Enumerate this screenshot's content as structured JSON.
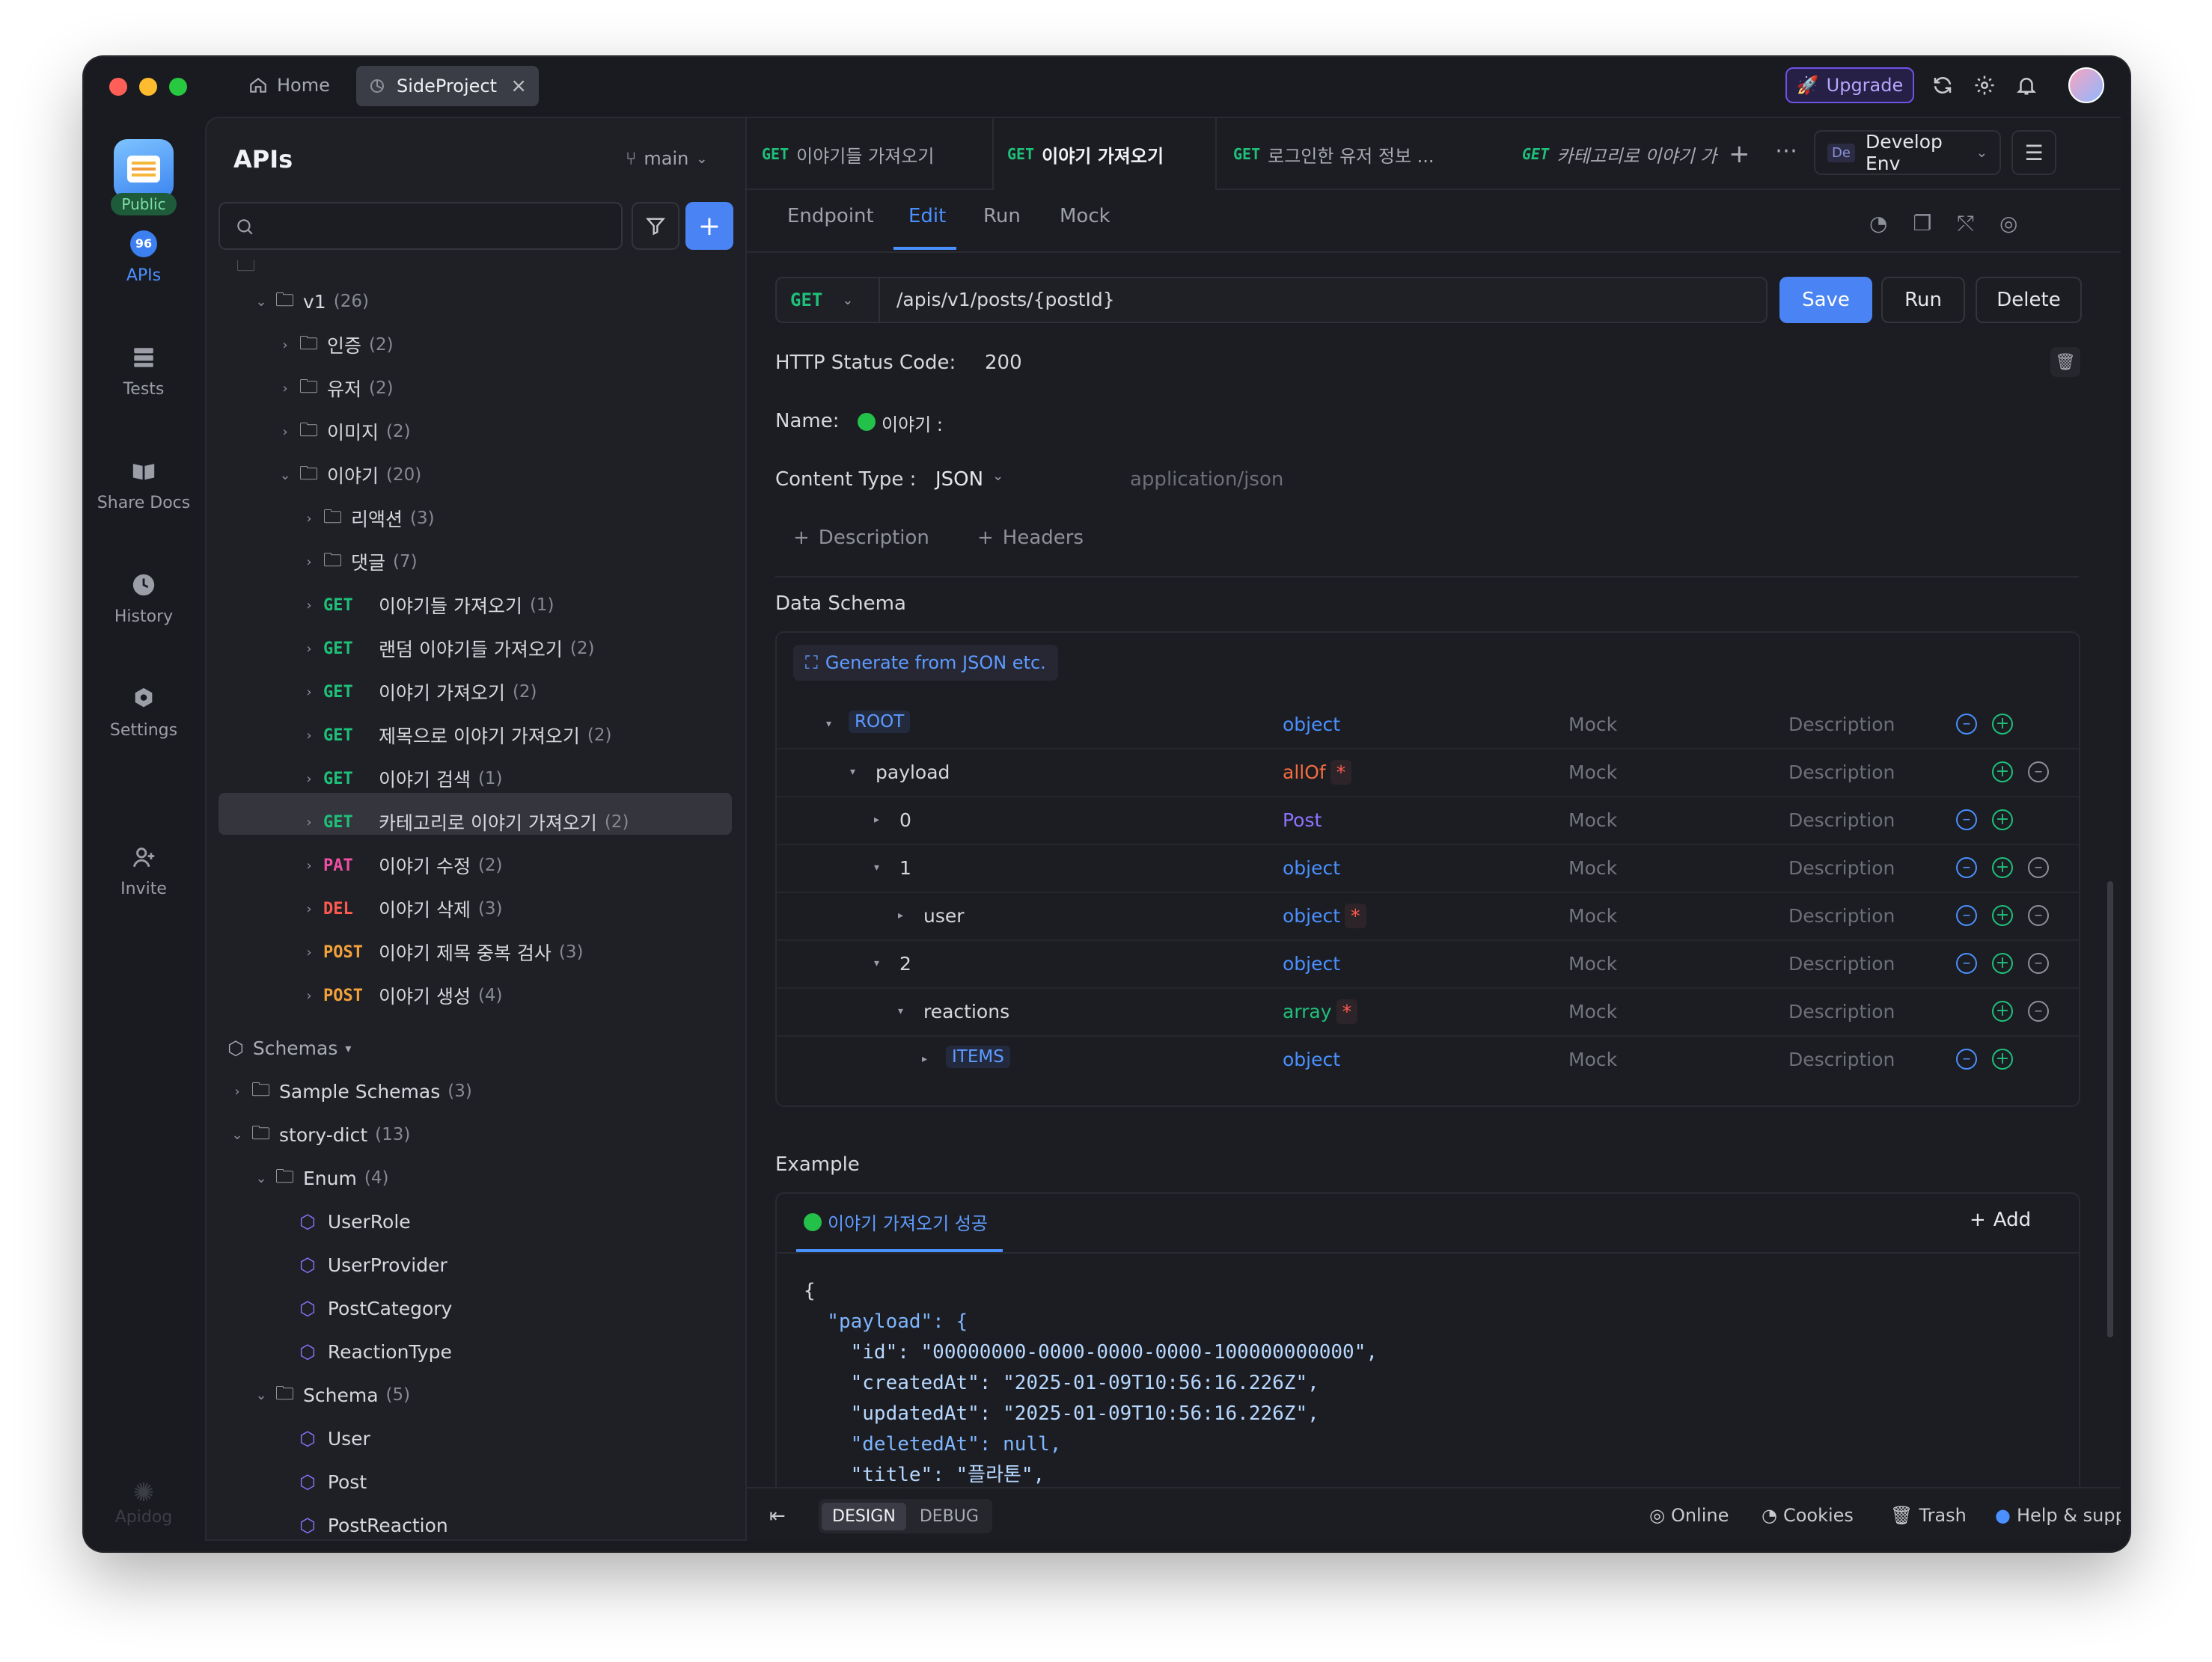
{
  "titlebar": {
    "home_tab": "Home",
    "active_tab": "SideProject",
    "upgrade_label": "Upgrade"
  },
  "rail": {
    "public_badge": "Public",
    "items": [
      {
        "label": "APIs",
        "icon": "api-icon"
      },
      {
        "label": "Tests",
        "icon": "tests-icon"
      },
      {
        "label": "Share Docs",
        "icon": "book-icon"
      },
      {
        "label": "History",
        "icon": "clock-icon"
      },
      {
        "label": "Settings",
        "icon": "gear-icon"
      },
      {
        "label": "Invite",
        "icon": "user-plus-icon"
      }
    ],
    "brand": "Apidog"
  },
  "sidebar": {
    "title": "APIs",
    "branch": "main",
    "search_placeholder": "",
    "tree": [
      {
        "label": "v1",
        "count": "(26)"
      },
      {
        "label": "인증",
        "count": "(2)"
      },
      {
        "label": "유저",
        "count": "(2)"
      },
      {
        "label": "이미지",
        "count": "(2)"
      },
      {
        "label": "이야기",
        "count": "(20)"
      },
      {
        "label": "리액션",
        "count": "(3)"
      },
      {
        "label": "댓글",
        "count": "(7)"
      }
    ],
    "endpoints": [
      {
        "method": "GET",
        "label": "이야기들 가져오기",
        "count": "(1)"
      },
      {
        "method": "GET",
        "label": "랜덤 이야기들 가져오기",
        "count": "(2)"
      },
      {
        "method": "GET",
        "label": "이야기 가져오기",
        "count": "(2)"
      },
      {
        "method": "GET",
        "label": "제목으로 이야기 가져오기",
        "count": "(2)"
      },
      {
        "method": "GET",
        "label": "이야기 검색",
        "count": "(1)"
      },
      {
        "method": "GET",
        "label": "카테고리로 이야기 가져오기",
        "count": "(2)"
      },
      {
        "method": "PAT",
        "label": "이야기 수정",
        "count": "(2)"
      },
      {
        "method": "DEL",
        "label": "이야기 삭제",
        "count": "(3)"
      },
      {
        "method": "POST",
        "label": "이야기 제목 중복 검사",
        "count": "(3)"
      },
      {
        "method": "POST",
        "label": "이야기 생성",
        "count": "(4)"
      }
    ],
    "schemas_title": "Schemas",
    "schema_tree": [
      {
        "label": "Sample Schemas",
        "count": "(3)"
      },
      {
        "label": "story-dict",
        "count": "(13)"
      },
      {
        "label": "Enum",
        "count": "(4)"
      },
      {
        "label": "UserRole"
      },
      {
        "label": "UserProvider"
      },
      {
        "label": "PostCategory"
      },
      {
        "label": "ReactionType"
      },
      {
        "label": "Schema",
        "count": "(5)"
      },
      {
        "label": "User"
      },
      {
        "label": "Post"
      },
      {
        "label": "PostReaction"
      }
    ]
  },
  "main": {
    "tabs": [
      {
        "method": "GET",
        "label": "이야기들 가져오기"
      },
      {
        "method": "GET",
        "label": "이야기 가져오기"
      },
      {
        "method": "GET",
        "label": "로그인한 유저 정보 ..."
      },
      {
        "method": "GET",
        "label": "카테고리로 이야기 가"
      }
    ],
    "env_badge": "De",
    "env_label": "Develop Env",
    "sub_tabs": [
      "Endpoint",
      "Edit",
      "Run",
      "Mock"
    ],
    "method": "GET",
    "url": "/apis/v1/posts/{postId}",
    "save_label": "Save",
    "run_label": "Run",
    "delete_label": "Delete",
    "status_label": "HTTP Status Code:",
    "status_value": "200",
    "name_label": "Name:",
    "name_value": "이야기 :",
    "content_type_label": "Content Type :",
    "content_type_value": "JSON",
    "content_type_mime": "application/json",
    "description_link": "Description",
    "headers_link": "Headers",
    "data_schema_title": "Data Schema",
    "generate_label": "Generate from JSON etc.",
    "schema_rows": [
      {
        "name": "ROOT",
        "type": "object",
        "mock": "Mock",
        "desc": "Description"
      },
      {
        "name": "payload",
        "type": "allOf",
        "mock": "Mock",
        "desc": "Description"
      },
      {
        "name": "0",
        "type": "Post",
        "mock": "Mock",
        "desc": "Description"
      },
      {
        "name": "1",
        "type": "object",
        "mock": "Mock",
        "desc": "Description"
      },
      {
        "name": "user",
        "type": "object",
        "mock": "Mock",
        "desc": "Description"
      },
      {
        "name": "2",
        "type": "object",
        "mock": "Mock",
        "desc": "Description"
      },
      {
        "name": "reactions",
        "type": "array",
        "mock": "Mock",
        "desc": "Description"
      },
      {
        "name": "ITEMS",
        "type": "object",
        "mock": "Mock",
        "desc": "Description"
      }
    ],
    "example_title": "Example",
    "example_tab": "이야기 가져오기 성공",
    "add_label": "Add",
    "code_lines": [
      "{",
      "  \"payload\": {",
      "    \"id\": \"00000000-0000-0000-0000-100000000000\",",
      "    \"createdAt\": \"2025-01-09T10:56:16.226Z\",",
      "    \"updatedAt\": \"2025-01-09T10:56:16.226Z\",",
      "    \"deletedAt\": null,",
      "    \"title\": \"플라톤\","
    ]
  },
  "bottom": {
    "design": "DESIGN",
    "debug": "DEBUG",
    "online": "Online",
    "cookies": "Cookies",
    "trash": "Trash",
    "help": "Help & support"
  },
  "colors": {
    "accent": "#4a90ff",
    "get": "#1fc07a",
    "patch": "#ee4fa2",
    "delete": "#ff5a4f",
    "post": "#f2a23a",
    "upgrade": "#6f52e6"
  }
}
